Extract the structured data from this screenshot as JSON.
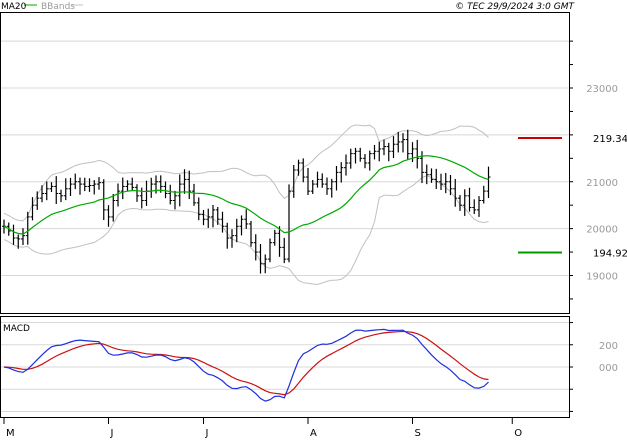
{
  "header": {
    "legend_ma": "MA20",
    "legend_bands": "BBands",
    "copyright": "© TEC 29/9/2024 3:0 GMT"
  },
  "colors": {
    "ma": "#00aa00",
    "bands": "#c0c0c0",
    "bars": "#000000",
    "grid": "#d8d8d8",
    "resistance": "#cc0000",
    "support": "#009900",
    "macd": "#1f2fdd",
    "signal": "#cc1111"
  },
  "chart_data": [
    {
      "type": "ohlc",
      "name": "price",
      "ylim": [
        18200,
        24600
      ],
      "yticks": [
        {
          "value": 19000,
          "label": "19000"
        },
        {
          "value": 20000,
          "label": "20000"
        },
        {
          "value": 21000,
          "label": "21000"
        },
        {
          "value": 23000,
          "label": "23000"
        }
      ],
      "x_labels": [
        {
          "index": 0,
          "label": "M"
        },
        {
          "index": 22,
          "label": "J"
        },
        {
          "index": 42,
          "label": "J"
        },
        {
          "index": 64,
          "label": "A"
        },
        {
          "index": 86,
          "label": "S"
        },
        {
          "index": 107,
          "label": "O"
        }
      ],
      "levels": [
        {
          "name": "resistance",
          "value": 21934,
          "label": "219.34"
        },
        {
          "name": "support",
          "value": 19492,
          "label": "194.92"
        }
      ],
      "close": [
        20050,
        19950,
        19800,
        19780,
        19850,
        20250,
        20500,
        20650,
        20750,
        20850,
        20900,
        20750,
        20700,
        20850,
        20950,
        21000,
        20950,
        20900,
        20920,
        20950,
        20980,
        20400,
        20250,
        20600,
        20800,
        20900,
        20950,
        20880,
        20700,
        20600,
        20800,
        20950,
        21000,
        20900,
        20750,
        20600,
        20700,
        20950,
        21050,
        20800,
        20550,
        20300,
        20200,
        20250,
        20400,
        20200,
        20050,
        19800,
        19850,
        20050,
        20200,
        20100,
        19700,
        19500,
        19250,
        19350,
        19700,
        19900,
        19600,
        19350,
        20800,
        21250,
        21400,
        21100,
        20800,
        20950,
        21050,
        20950,
        20850,
        21000,
        21200,
        21300,
        21400,
        21600,
        21650,
        21500,
        21400,
        21600,
        21650,
        21700,
        21750,
        21650,
        21800,
        21850,
        21900,
        21600,
        21700,
        21500,
        21200,
        21150,
        21050,
        21000,
        20950,
        21000,
        20850,
        20650,
        20500,
        20700,
        20450,
        20400,
        20600,
        20800,
        21100
      ]
    },
    {
      "type": "line",
      "name": "MACD",
      "ylim": [
        -450,
        450
      ],
      "yticks": [
        {
          "value": 0,
          "label": "000"
        },
        {
          "value": 200,
          "label": "200"
        }
      ]
    }
  ]
}
